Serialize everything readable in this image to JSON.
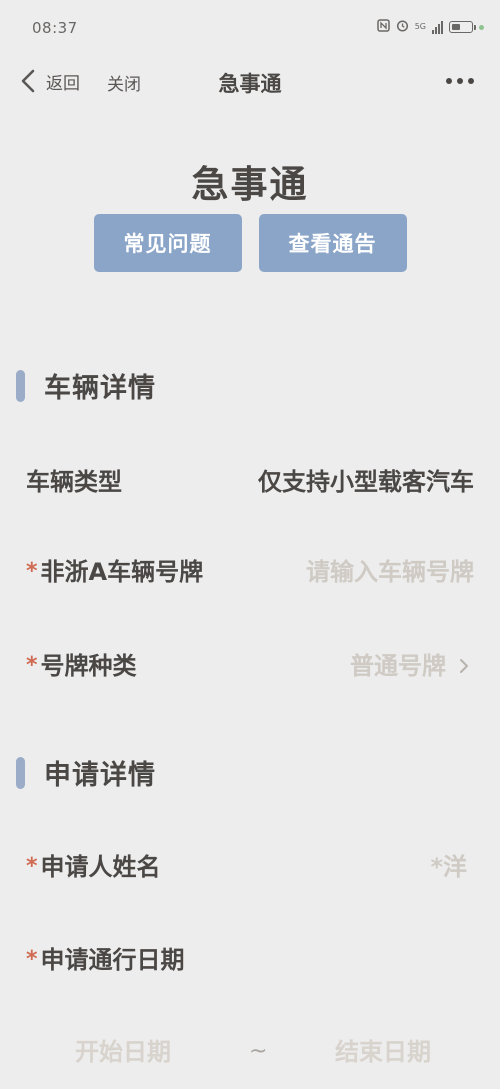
{
  "status_bar": {
    "time": "08:37",
    "network": "5G"
  },
  "nav": {
    "back_label": "返回",
    "close_label": "关闭",
    "title": "急事通"
  },
  "header": {
    "title": "急事通",
    "buttons": [
      "常见问题",
      "查看通告"
    ]
  },
  "vehicle_section": {
    "title": "车辆详情",
    "type_label": "车辆类型",
    "type_value": "仅支持小型载客汽车",
    "plate_label": "非浙A车辆号牌",
    "plate_placeholder": "请输入车辆号牌",
    "plate_kind_label": "号牌种类",
    "plate_kind_value": "普通号牌"
  },
  "apply_section": {
    "title": "申请详情",
    "applicant_label": "申请人姓名",
    "applicant_value": "*洋",
    "date_label": "申请通行日期",
    "start_placeholder": "开始日期",
    "separator": "~",
    "end_placeholder": "结束日期"
  },
  "colors": {
    "background": "#ededed",
    "button": "#8aa5c8",
    "section_bar": "#9aacc8",
    "required": "#d06a52",
    "placeholder": "#cfcac4"
  }
}
